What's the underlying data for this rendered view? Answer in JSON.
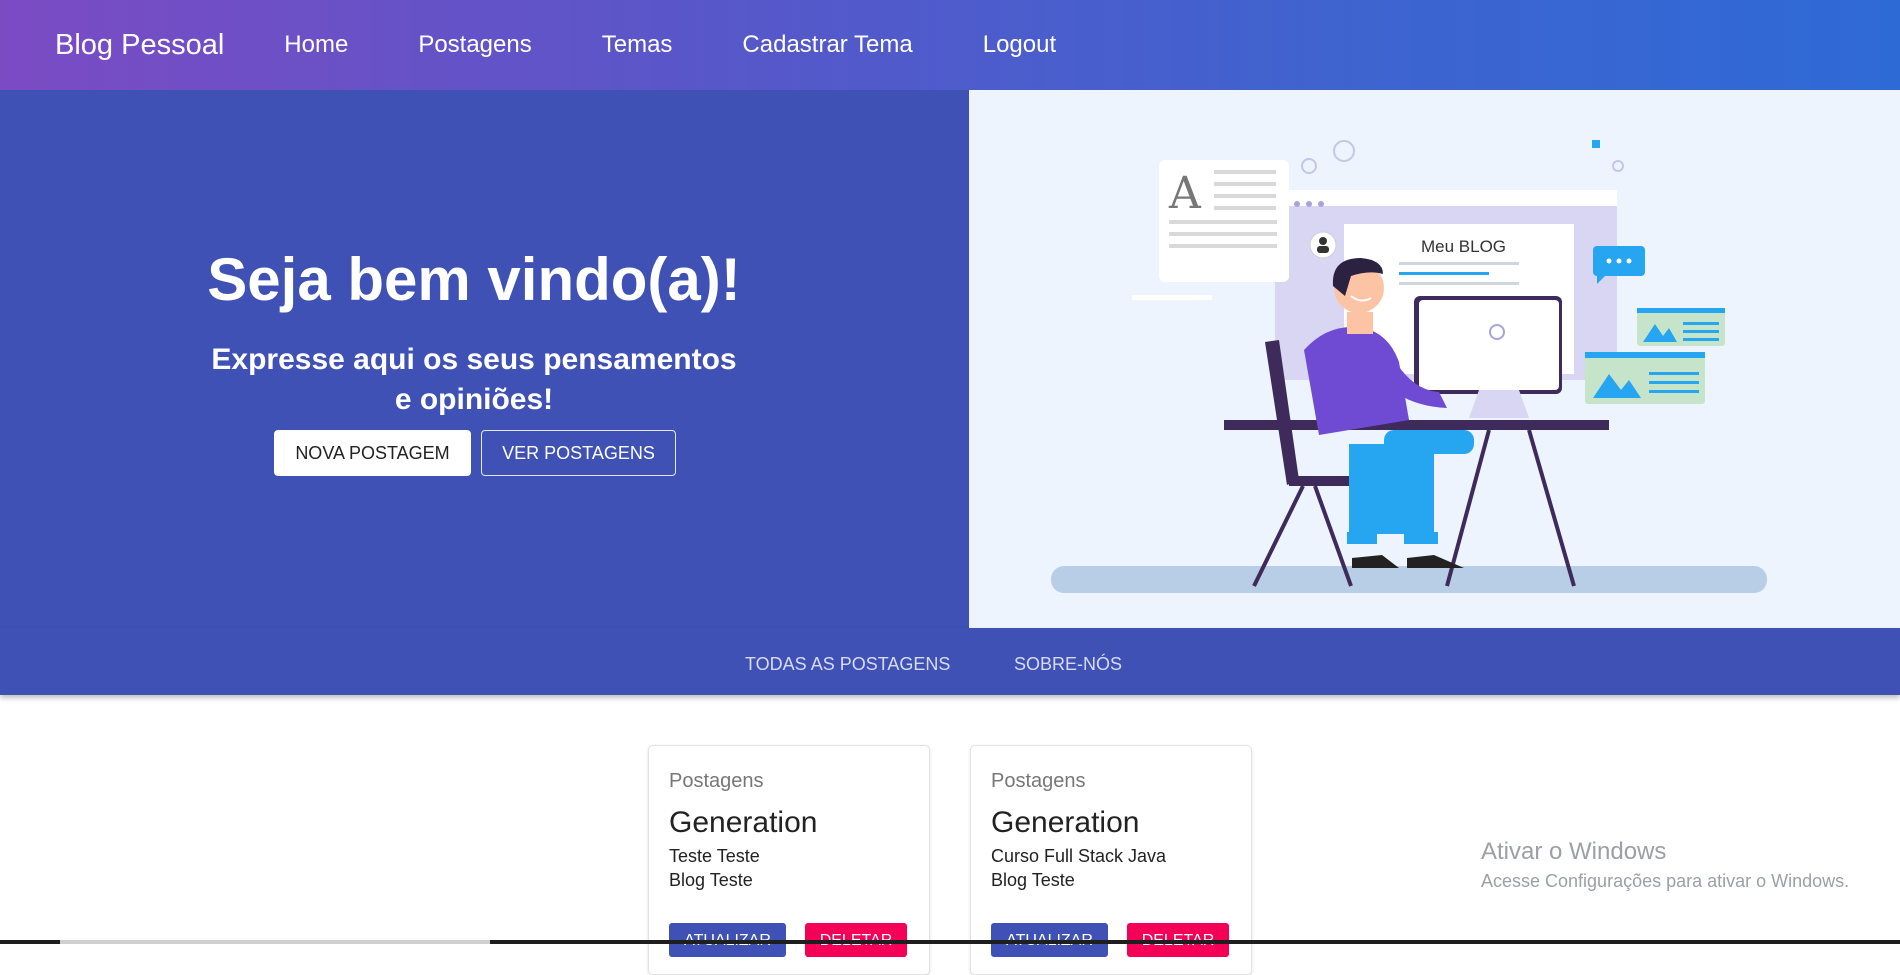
{
  "navbar": {
    "brand": "Blog Pessoal",
    "items": [
      "Home",
      "Postagens",
      "Temas",
      "Cadastrar Tema",
      "Logout"
    ]
  },
  "hero": {
    "title": "Seja bem vindo(a)!",
    "subtitle_line1": "Expresse aqui os seus pensamentos",
    "subtitle_line2": "e opiniões!",
    "new_post_button": "NOVA POSTAGEM",
    "see_posts_button": "VER POSTAGENS",
    "illustration_caption": "Meu BLOG"
  },
  "tabs": [
    "TODAS AS POSTAGENS",
    "SOBRE-NÓS"
  ],
  "posts": [
    {
      "section": "Postagens",
      "title": "Generation",
      "line1": "Teste Teste",
      "line2": "Blog Teste",
      "update": "ATUALIZAR",
      "delete": "DELETAR"
    },
    {
      "section": "Postagens",
      "title": "Generation",
      "line1": "Curso Full Stack Java",
      "line2": "Blog Teste",
      "update": "ATUALIZAR",
      "delete": "DELETAR"
    }
  ],
  "watermark": {
    "title": "Ativar o Windows",
    "subtitle": "Acesse Configurações para ativar o Windows."
  },
  "colors": {
    "primary": "#3f51b5",
    "secondary": "#f50057",
    "hero_bg": "#edf4fd"
  }
}
